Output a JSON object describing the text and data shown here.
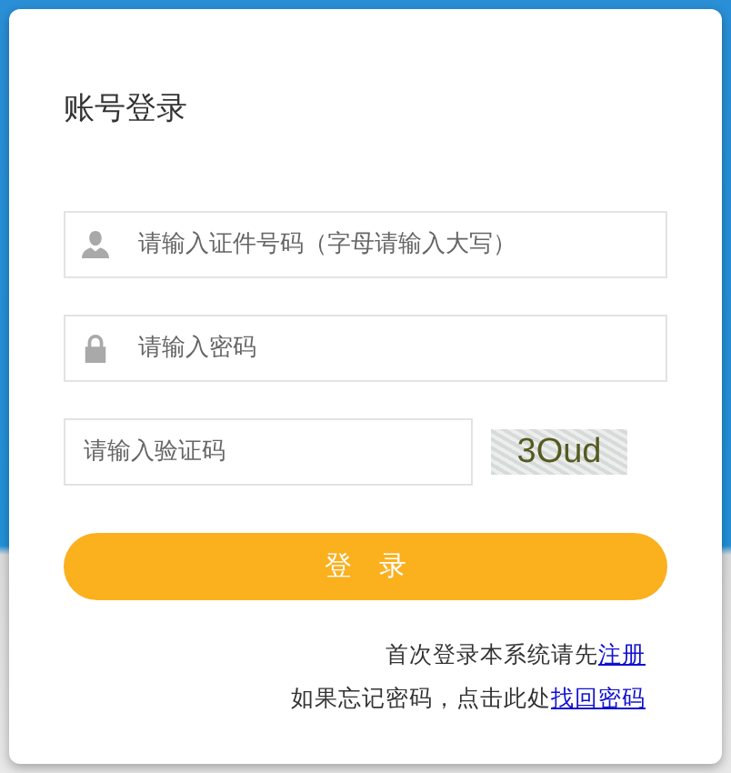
{
  "title": "账号登录",
  "fields": [
    {
      "kind": "user",
      "placeholder": "请输入证件号码（字母请输入大写）"
    },
    {
      "kind": "lock",
      "placeholder": "请输入密码"
    }
  ],
  "captcha": {
    "placeholder": "请输入验证码",
    "code": "3Oud"
  },
  "login_button": "登　录",
  "register_line": {
    "text": "首次登录本系统请先",
    "link": "注册"
  },
  "recover_line": {
    "text": "如果忘记密码，点击此处",
    "link": "找回密码"
  }
}
